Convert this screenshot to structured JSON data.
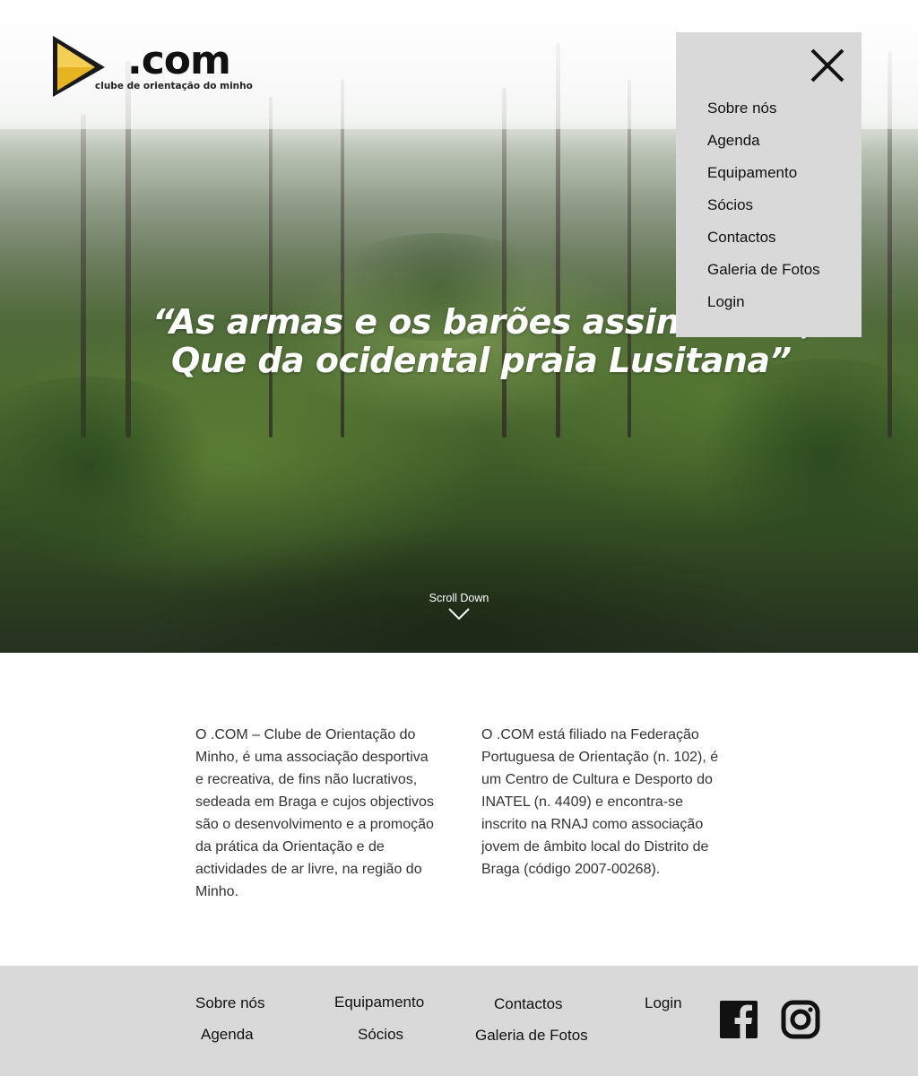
{
  "brand": {
    "logo_text": ".com",
    "logo_subtitle": "clube de orientação do minho"
  },
  "hero": {
    "quote_line1": "“As armas e os barões assinalados,",
    "quote_line2": "Que da ocidental praia Lusitana”",
    "scroll_label": "Scroll Down"
  },
  "menu": {
    "open": true,
    "items": [
      "Sobre nós",
      "Agenda",
      "Equipamento",
      "Sócios",
      "Contactos",
      "Galeria de Fotos",
      "Login"
    ]
  },
  "about": {
    "left": "O .COM – Clube de Orientação do Minho, é uma associação desportiva e recreativa, de fins não lucrativos, sedeada em Braga e cujos objectivos são o desenvolvimento e a promoção da prática da Orientação e de actividades de ar livre, na região do Minho.",
    "right": "O .COM está filiado na Federação Portuguesa de Orientação (n. 102), é um Centro de Cultura e Desporto do INATEL (n. 4409) e encontra-se inscrito na RNAJ como associação jovem de âmbito local do Distrito de Braga (código 2007-00268)."
  },
  "footer": {
    "links": {
      "sobre": "Sobre nós",
      "agenda": "Agenda",
      "equipamento": "Equipamento",
      "socios": "Sócios",
      "contactos": "Contactos",
      "galeria": "Galeria de Fotos",
      "login": "Login"
    },
    "social": [
      "facebook-icon",
      "instagram-icon"
    ]
  },
  "colors": {
    "menu_bg": "#d9d9d9",
    "footer_bg": "#d9d9d9",
    "logo_gold": "#e8b320"
  }
}
